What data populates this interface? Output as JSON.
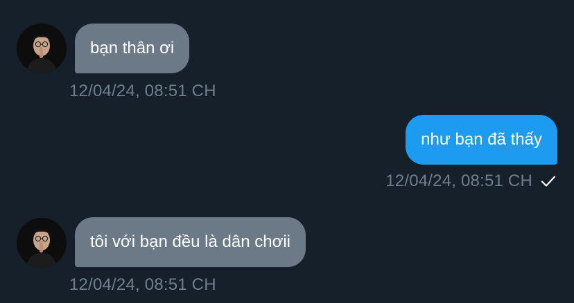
{
  "messages": [
    {
      "direction": "incoming",
      "text": "bạn thân ơi",
      "timestamp": "12/04/24, 08:51 CH",
      "avatar_icon": "user-avatar"
    },
    {
      "direction": "outgoing",
      "text": "như bạn đã thấy",
      "timestamp": "12/04/24, 08:51 CH",
      "status_icon": "checkmark-icon"
    },
    {
      "direction": "incoming",
      "text": "tôi với bạn đều là dân chơii",
      "timestamp": "12/04/24, 08:51 CH",
      "avatar_icon": "user-avatar"
    }
  ],
  "colors": {
    "background": "#15202b",
    "incoming_bubble": "#6c7a88",
    "outgoing_bubble": "#1d9bf0",
    "timestamp_text": "#6f7f8d"
  }
}
